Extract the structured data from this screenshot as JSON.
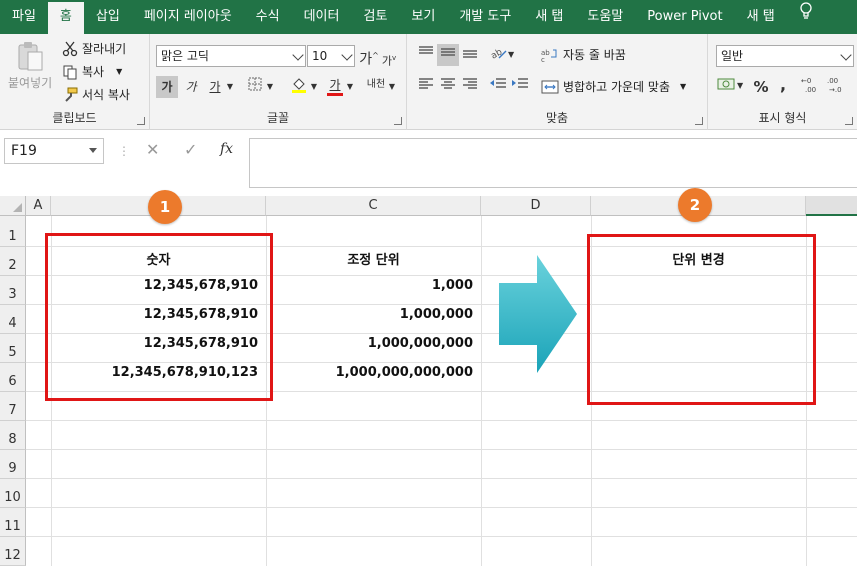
{
  "ribbon_tabs": [
    "파일",
    "홈",
    "삽입",
    "페이지 레이아웃",
    "수식",
    "데이터",
    "검토",
    "보기",
    "개발 도구",
    "새 탭",
    "도움말",
    "Power Pivot",
    "새 탭"
  ],
  "clipboard": {
    "paste_label": "붙여넣기",
    "cut_label": "잘라내기",
    "copy_label": "복사",
    "format_painter_label": "서식 복사",
    "group_label": "클립보드"
  },
  "font": {
    "font_name": "맑은 고딕",
    "font_size": "10",
    "grow_label": "가",
    "shrink_label": "가",
    "bold_label": "가",
    "italic_label": "가",
    "underline_label": "가",
    "font_color_label": "가",
    "phonetic_label": "내천",
    "group_label": "글꼴"
  },
  "alignment": {
    "wrap_label": "자동 줄 바꿈",
    "merge_label": "병합하고 가운데 맞춤",
    "group_label": "맞춤"
  },
  "number": {
    "format_value": "일반",
    "percent_label": "%",
    "comma_label": ",",
    "group_label": "표시 형식"
  },
  "formula_bar": {
    "name_box": "F19",
    "cancel": "✕",
    "enter": "✓",
    "fx": "fx",
    "formula": ""
  },
  "columns": [
    "A",
    "B",
    "C",
    "D",
    "E"
  ],
  "rows": [
    "1",
    "2",
    "3",
    "4",
    "5",
    "6",
    "7",
    "8",
    "9",
    "10",
    "11",
    "12"
  ],
  "cells": {
    "B2": "숫자",
    "C2": "조정 단위",
    "E2": "단위 변경",
    "B3": "12,345,678,910",
    "B4": "12,345,678,910",
    "B5": "12,345,678,910",
    "B6": "12,345,678,910,123",
    "C3": "1,000",
    "C4": "1,000,000",
    "C5": "1,000,000,000",
    "C6": "1,000,000,000,000"
  },
  "annotations": {
    "badge_1": "1",
    "badge_2": "2",
    "highlight_color": "#e01616",
    "badge_color": "#ec7a2c",
    "arrow_color": "#3fbfcf"
  },
  "colors": {
    "excel_green": "#217346",
    "ribbon_bg": "#f3f3f3"
  }
}
